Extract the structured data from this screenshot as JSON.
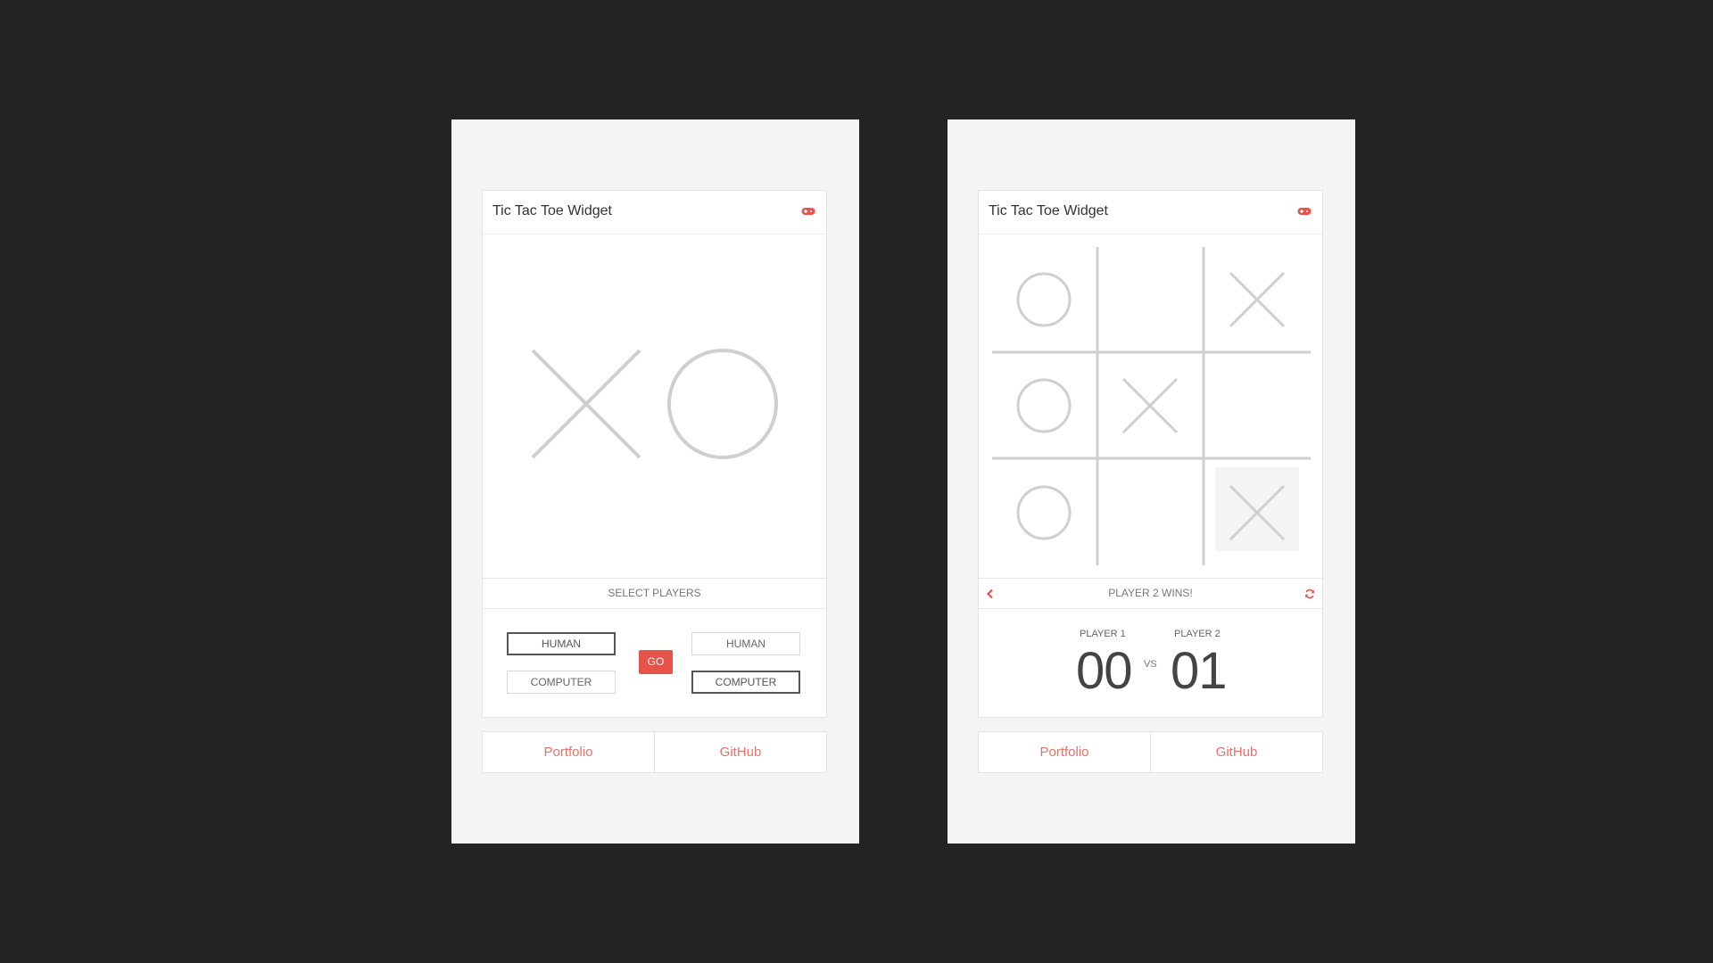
{
  "accent_color": "#e5534b",
  "screens": {
    "select": {
      "title": "Tic Tac Toe Widget",
      "header_icon": "gamepad-icon",
      "status_text": "SELECT PLAYERS",
      "player1_options": [
        "HUMAN",
        "COMPUTER"
      ],
      "player1_selected": "HUMAN",
      "player2_options": [
        "HUMAN",
        "COMPUTER"
      ],
      "player2_selected": "COMPUTER",
      "go_label": "GO",
      "links": [
        "Portfolio",
        "GitHub"
      ]
    },
    "game": {
      "title": "Tic Tac Toe Widget",
      "header_icon": "gamepad-icon",
      "board": [
        [
          "O",
          "",
          "X"
        ],
        [
          "O",
          "X",
          ""
        ],
        [
          "O",
          "",
          "X"
        ]
      ],
      "highlighted_cell": [
        2,
        2
      ],
      "status_text": "PLAYER 2 WINS!",
      "back_icon": "chevron-left-icon",
      "restart_icon": "refresh-icon",
      "player1_label": "PLAYER 1",
      "player2_label": "PLAYER 2",
      "player1_score": "00",
      "player2_score": "01",
      "vs_label": "VS",
      "links": [
        "Portfolio",
        "GitHub"
      ]
    }
  }
}
